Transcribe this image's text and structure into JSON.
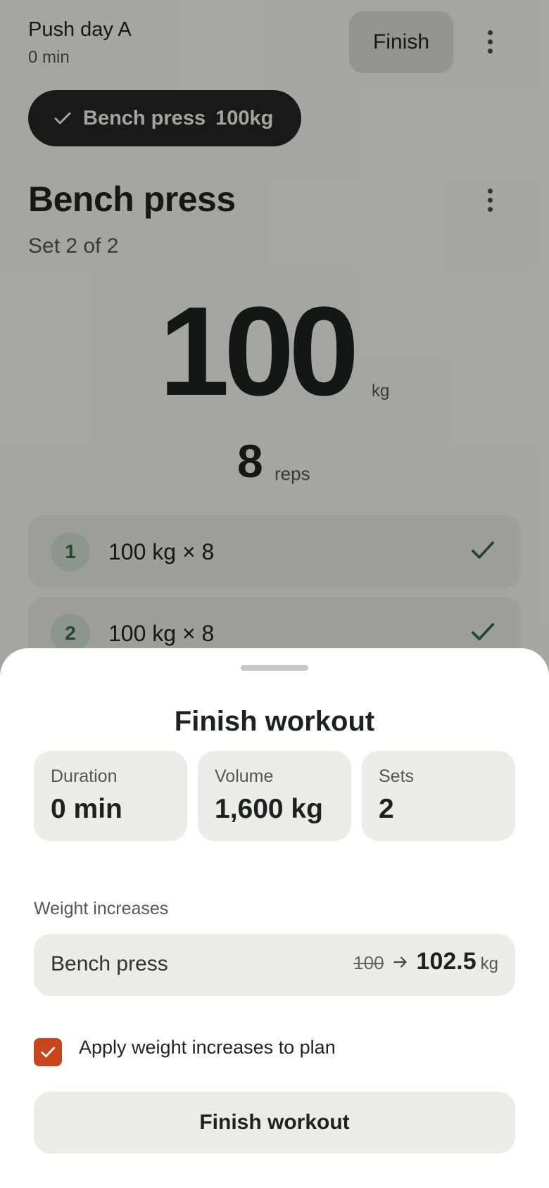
{
  "workout": {
    "title": "Push day A",
    "elapsed": "0 min",
    "finish_label": "Finish"
  },
  "completed_chip": {
    "exercise": "Bench press",
    "weight": "100kg"
  },
  "exercise": {
    "name": "Bench press",
    "set_progress": "Set 2 of 2",
    "weight": "100",
    "weight_unit": "kg",
    "reps": "8",
    "reps_unit": "reps"
  },
  "sets": [
    {
      "number": "1",
      "summary": "100 kg × 8",
      "done": true
    },
    {
      "number": "2",
      "summary": "100 kg × 8",
      "done": true
    }
  ],
  "sheet": {
    "title": "Finish workout",
    "stats": [
      {
        "label": "Duration",
        "value": "0 min"
      },
      {
        "label": "Volume",
        "value": "1,600 kg"
      },
      {
        "label": "Sets",
        "value": "2"
      }
    ],
    "increases_label": "Weight increases",
    "increase": {
      "exercise": "Bench press",
      "old": "100",
      "new": "102.5",
      "unit": "kg"
    },
    "apply_label": "Apply weight increases to plan",
    "apply_checked": true,
    "finish_button": "Finish workout"
  },
  "colors": {
    "accent": "#c9461c",
    "success": "#2e6b45",
    "chip_bg": "#252626"
  }
}
